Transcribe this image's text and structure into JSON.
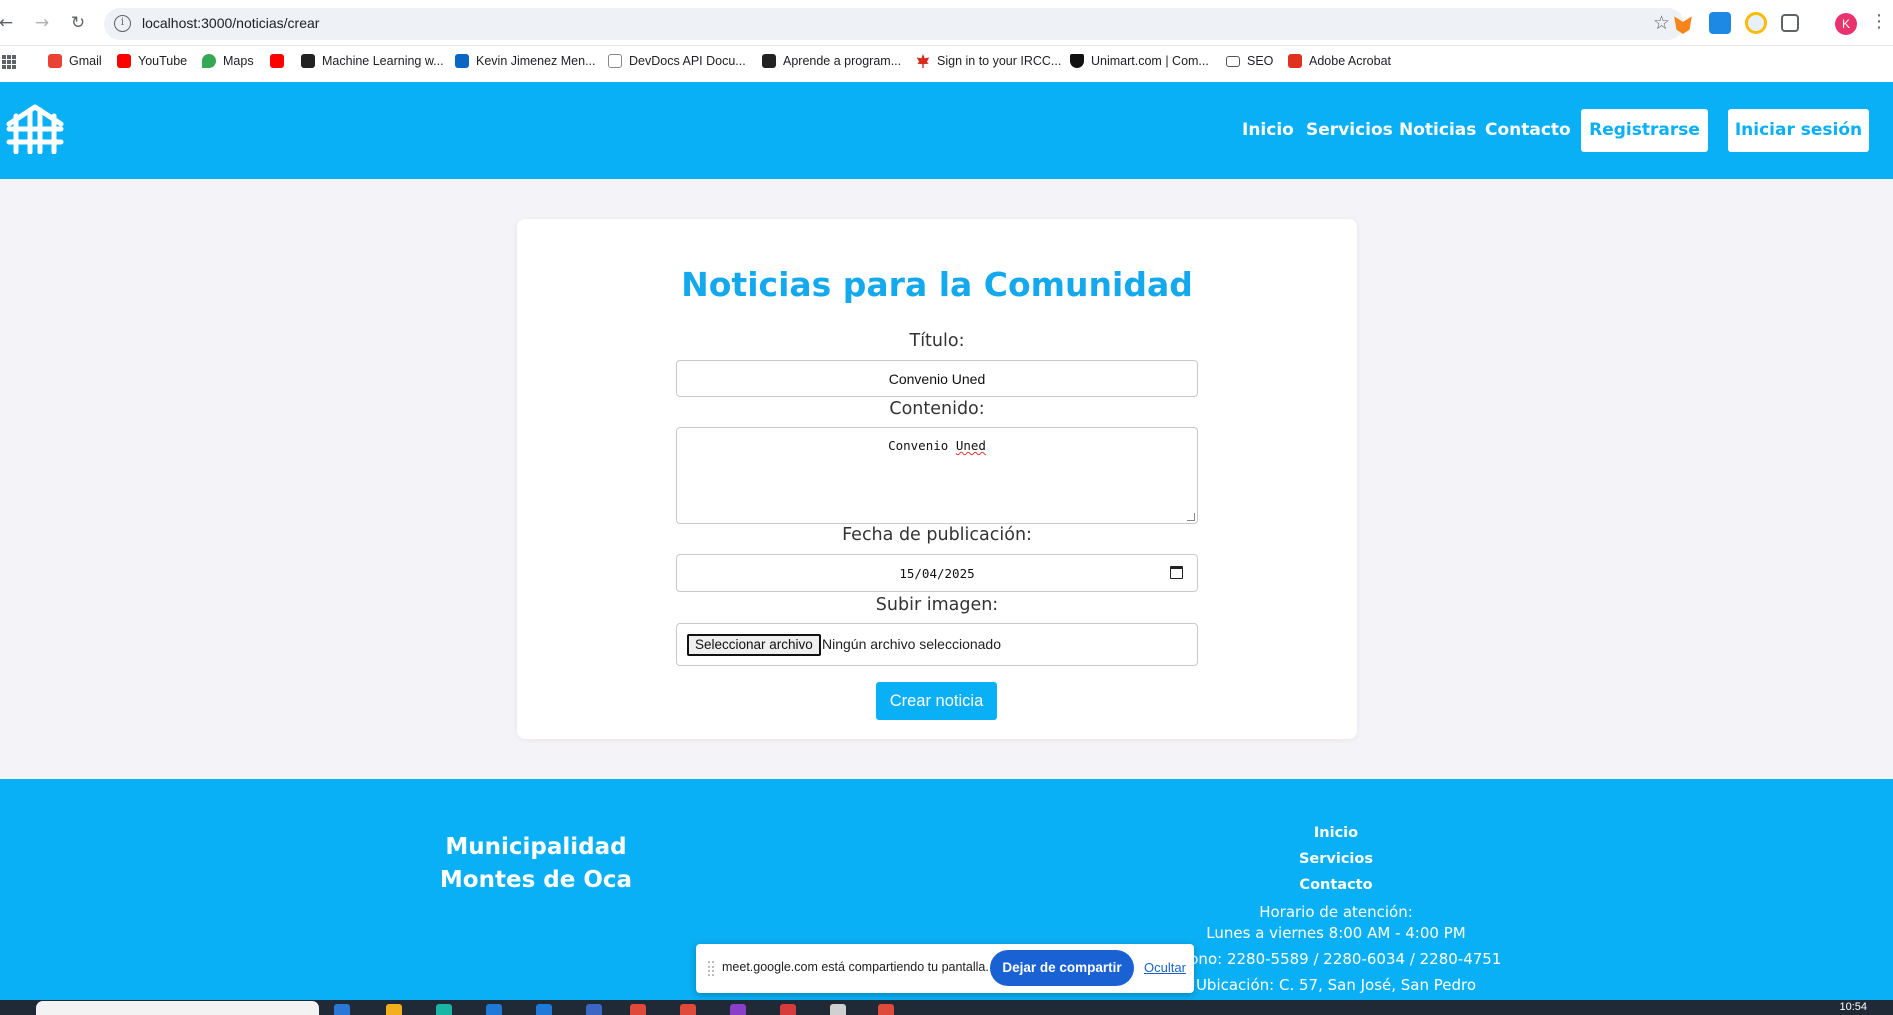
{
  "browser": {
    "url": "localhost:3000/noticias/crear",
    "profile_initial": "K",
    "bookmarks": [
      {
        "label": "Gmail",
        "icon": "gmail-icon",
        "color": "#ea4335"
      },
      {
        "label": "YouTube",
        "icon": "youtube-icon",
        "color": "#ff0000"
      },
      {
        "label": "Maps",
        "icon": "maps-icon",
        "color": "#34a853"
      },
      {
        "label": "",
        "icon": "youtube-music-icon",
        "color": "#ff0000"
      },
      {
        "label": "Machine Learning w...",
        "icon": "ml-icon",
        "color": "#222222"
      },
      {
        "label": "Kevin Jimenez Men...",
        "icon": "linkedin-icon",
        "color": "#0a66c2"
      },
      {
        "label": "DevDocs API Docu...",
        "icon": "devdocs-icon",
        "color": "#888888"
      },
      {
        "label": "Aprende a program...",
        "icon": "code-icon",
        "color": "#222222"
      },
      {
        "label": "Sign in to your IRCC...",
        "icon": "maple-leaf-icon",
        "color": "#d52b1e"
      },
      {
        "label": "Unimart.com | Com...",
        "icon": "unimart-icon",
        "color": "#111111"
      },
      {
        "label": "SEO",
        "icon": "folder-icon",
        "color": "#555555"
      },
      {
        "label": "Adobe Acrobat",
        "icon": "acrobat-icon",
        "color": "#e0301e"
      }
    ]
  },
  "header": {
    "nav": [
      "Inicio",
      "Servicios",
      "Noticias",
      "Contacto"
    ],
    "register_label": "Registrarse",
    "login_label": "Iniciar sesión"
  },
  "form": {
    "heading": "Noticias para la Comunidad",
    "title_label": "Título:",
    "title_value": "Convenio Uned",
    "content_label": "Contenido:",
    "content_value_a": "Convenio",
    "content_value_b": "Uned",
    "date_label": "Fecha de publicación:",
    "date_value": "15/04/2025",
    "image_label": "Subir imagen:",
    "file_button": "Seleccionar archivo",
    "file_status": "Ningún archivo seleccionado",
    "submit_label": "Crear noticia"
  },
  "footer": {
    "org_line1": "Municipalidad",
    "org_line2": "Montes de Oca",
    "links": [
      "Inicio",
      "Servicios",
      "Contacto"
    ],
    "hours_title": "Horario de atención:",
    "hours": "Lunes a viernes 8:00 AM - 4:00 PM",
    "phone": "léfono: 2280-5589 / 2280-6034 / 2280-4751",
    "location": "Ubicación: C. 57, San José, San Pedro"
  },
  "share_bar": {
    "text": "meet.google.com está compartiendo tu pantalla.",
    "stop_label": "Dejar de compartir",
    "hide_label": "Ocultar"
  },
  "taskbar": {
    "time": "10:54"
  },
  "colors": {
    "brand": "#0ab0f5",
    "heading": "#13a9ec",
    "background": "#f4f3f7",
    "share_button": "#1a62d4"
  }
}
